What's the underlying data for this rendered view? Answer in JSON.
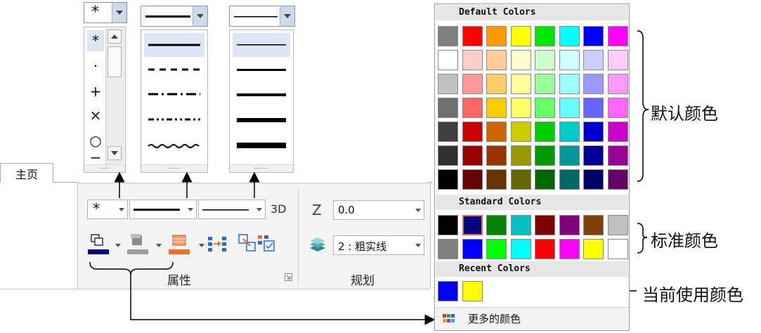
{
  "tab": {
    "home": "主页"
  },
  "markers": {
    "items": [
      "*",
      "·",
      "+",
      "×",
      "○",
      "−"
    ],
    "selected": "*"
  },
  "ribbon": {
    "marker_value": "*",
    "threed": "3D",
    "z_label": "Z",
    "z_value": "0.0",
    "layer_value": "2 : 粗实线",
    "group_properties": "属性",
    "group_plan": "规划"
  },
  "picker": {
    "default_header": "Default Colors",
    "standard_header": "Standard Colors",
    "recent_header": "Recent Colors",
    "more_colors": "更多的颜色",
    "default_colors": [
      [
        "#808080",
        "#ff0000",
        "#ff9900",
        "#ffff00",
        "#00e600",
        "#00ffff",
        "#0000ff",
        "#ff00ff"
      ],
      [
        "#ffffff",
        "#ffcccc",
        "#ffcc99",
        "#ffffcc",
        "#ccffcc",
        "#ccffff",
        "#ccccff",
        "#ffccff"
      ],
      [
        "#c0c0c0",
        "#ff9999",
        "#ffcc66",
        "#ffff99",
        "#99ff99",
        "#99ffff",
        "#9999ff",
        "#ff99ff"
      ],
      [
        "#6f6f6f",
        "#ff6666",
        "#ffcc00",
        "#ffff66",
        "#66ff66",
        "#66ffff",
        "#6666ff",
        "#ff66ff"
      ],
      [
        "#404040",
        "#cc0000",
        "#cc6600",
        "#cccc00",
        "#00cc00",
        "#00cccc",
        "#0000cc",
        "#cc00cc"
      ],
      [
        "#303030",
        "#990000",
        "#993300",
        "#999900",
        "#009900",
        "#009999",
        "#000099",
        "#990099"
      ],
      [
        "#000000",
        "#660000",
        "#663300",
        "#666600",
        "#006600",
        "#006666",
        "#000066",
        "#660066"
      ]
    ],
    "standard_colors": [
      [
        "#000000",
        "#000080",
        "#008000",
        "#00c0c0",
        "#800000",
        "#800080",
        "#804000",
        "#c0c0c0"
      ],
      [
        "#808080",
        "#0000ff",
        "#00ff00",
        "#00ffff",
        "#ff0000",
        "#ff00ff",
        "#ffff00",
        "#ffffff"
      ]
    ],
    "recent_colors": [
      "#0000ff",
      "#ffff00"
    ]
  },
  "annotations": {
    "default": "默认颜色",
    "standard": "标准颜色",
    "current": "当前使用颜色"
  }
}
